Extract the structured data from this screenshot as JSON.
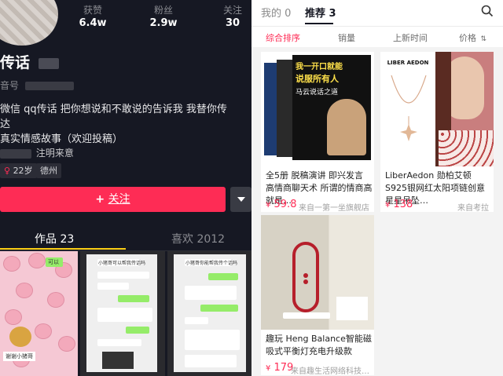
{
  "profile": {
    "stats": [
      {
        "label": "获赞",
        "value": "6.4w"
      },
      {
        "label": "粉丝",
        "value": "2.9w"
      },
      {
        "label": "关注",
        "value": "30"
      }
    ],
    "name_prefix": "传话",
    "id_suffix": "音号",
    "bio_line1": "微信 qq传话 把你想说和不敢说的告诉我 我替你传达",
    "bio_line2": "真实情感故事（欢迎投稿）",
    "notice": "注明来意",
    "tag_age": "22岁",
    "tag_city": "德州",
    "follow_plus": "+",
    "follow_label": "关注",
    "tabs": [
      {
        "label": "作品 23"
      },
      {
        "label": "喜欢 2012"
      }
    ],
    "thumb_texts": {
      "t1_bubble": "可以",
      "t1_caption": "谢谢小猪哥",
      "t2_a": "小猪哥可以帮我传话吗",
      "t3_a": "小猪哥你能帮我传个话吗"
    }
  },
  "shop": {
    "tabs": [
      {
        "label": "我的 0"
      },
      {
        "label": "推荐 3"
      }
    ],
    "sort": [
      {
        "label": "综合排序"
      },
      {
        "label": "销量"
      },
      {
        "label": "上新时间"
      },
      {
        "label": "价格"
      }
    ],
    "products": [
      {
        "title": "全5册 脱稿演讲 即兴发言 高情商聊天术 所谓的情商高就是…",
        "price": "59.8",
        "currency": "¥",
        "source": "来自一第一坐旗舰店",
        "cover_text": "我一开口就能",
        "cover_text2": "说服所有人",
        "cover_sub": "马云说话之道"
      },
      {
        "title": "LiberAedon 勋柏艾顿 S925银网红太阳项链创意星星吊坠…",
        "price": "138",
        "currency": "¥",
        "source": "来自考拉",
        "brand": "LIBER AEDON"
      },
      {
        "title": "趣玩 Heng Balance智能磁吸式平衡灯充电升级款",
        "price": "179",
        "currency": "¥",
        "source": "来自趣生活网络科技…"
      }
    ]
  },
  "colors": {
    "accent": "#fe2c55",
    "dark_bg": "#161823",
    "tab_indicator": "#face15"
  }
}
